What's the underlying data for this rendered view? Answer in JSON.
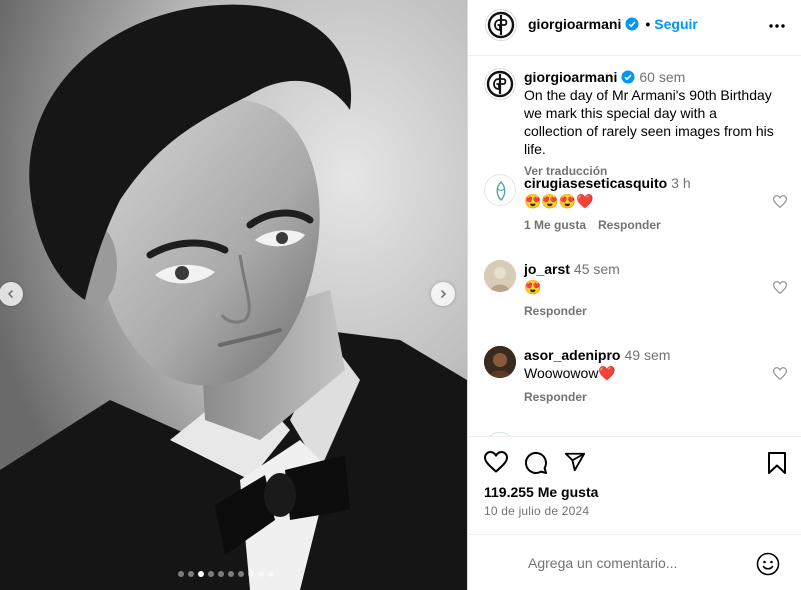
{
  "post": {
    "author": "giorgioarmani",
    "follow_label": "Seguir",
    "separator": "•",
    "image_count": 10,
    "active_image_index": 2,
    "caption": {
      "username": "giorgioarmani",
      "time": "60 sem",
      "text": "On the day of Mr Armani's 90th Birthday we mark this special day with a collection of rarely seen images from his life.",
      "translate_label": "Ver traducción"
    },
    "comments": [
      {
        "username": "cirugiaseseticasquito",
        "time": "3 h",
        "text": "😍😍😍❤️",
        "likes_label": "1 Me gusta",
        "reply_label": "Responder"
      },
      {
        "username": "jo_arst",
        "time": "45 sem",
        "text": "😍",
        "reply_label": "Responder"
      },
      {
        "username": "asor_adenipro",
        "time": "49 sem",
        "text": "Woowowow❤️",
        "reply_label": "Responder"
      }
    ],
    "likes": "119.255 Me gusta",
    "date": "10 de julio de 2024",
    "comment_placeholder": "Agrega un comentario..."
  },
  "colors": {
    "accent": "#0095f6",
    "muted": "#737373",
    "border": "#dbdbdb"
  },
  "icons": [
    "chevron-left-icon",
    "chevron-right-icon",
    "verified-badge-icon",
    "more-options-icon",
    "heart-icon",
    "comment-icon",
    "share-icon",
    "bookmark-icon",
    "emoji-icon"
  ]
}
